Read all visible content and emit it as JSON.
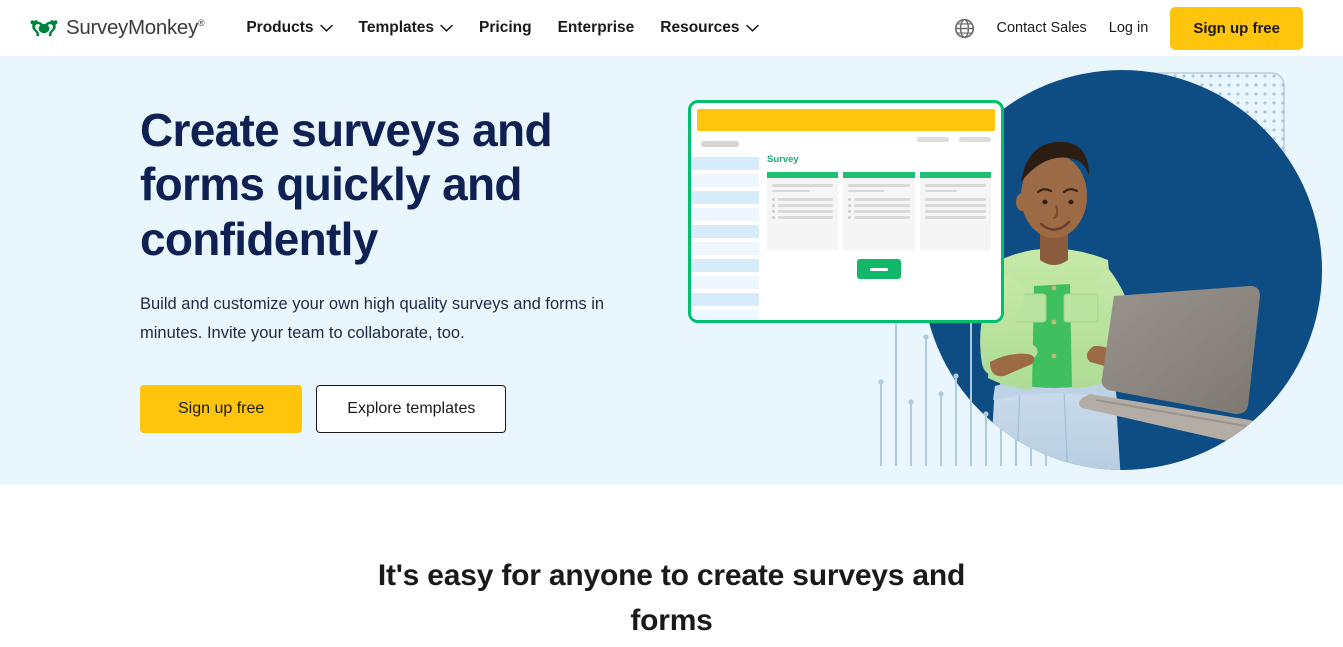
{
  "header": {
    "logo": {
      "icon": "surveymonkey-monkey-icon",
      "text": "SurveyMonkey",
      "registered_mark": "®"
    },
    "nav": [
      {
        "label": "Products",
        "has_dropdown": true
      },
      {
        "label": "Templates",
        "has_dropdown": true
      },
      {
        "label": "Pricing",
        "has_dropdown": false
      },
      {
        "label": "Enterprise",
        "has_dropdown": false
      },
      {
        "label": "Resources",
        "has_dropdown": true
      }
    ],
    "language_icon": "globe-icon",
    "contact_sales": "Contact Sales",
    "log_in": "Log in",
    "sign_up": "Sign up free"
  },
  "hero": {
    "heading": "Create surveys and forms quickly and confidently",
    "subheading": "Build and customize your own high quality surveys and forms in minutes. Invite your team to collaborate, too.",
    "primary_cta": "Sign up free",
    "secondary_cta": "Explore templates",
    "background_color": "#EAF6FD",
    "illustration": {
      "card_title": "Survey",
      "card_border_color": "#00BF6F",
      "card_topbar_color": "#FFC40C",
      "card_title_color": "#1BA97B",
      "submit_button_color": "#12B76A",
      "circle_color": "#0E4C84",
      "accent_dot_color": "#A9C6DC",
      "person_alt": "woman-with-laptop-photo"
    }
  },
  "section": {
    "heading": "It's easy for anyone to create surveys and forms"
  },
  "colors": {
    "brand_yellow": "#FFC40C",
    "brand_green": "#00BF6F",
    "navy": "#0E2152",
    "deep_blue": "#0E4C84",
    "hero_bg": "#EAF6FD"
  }
}
